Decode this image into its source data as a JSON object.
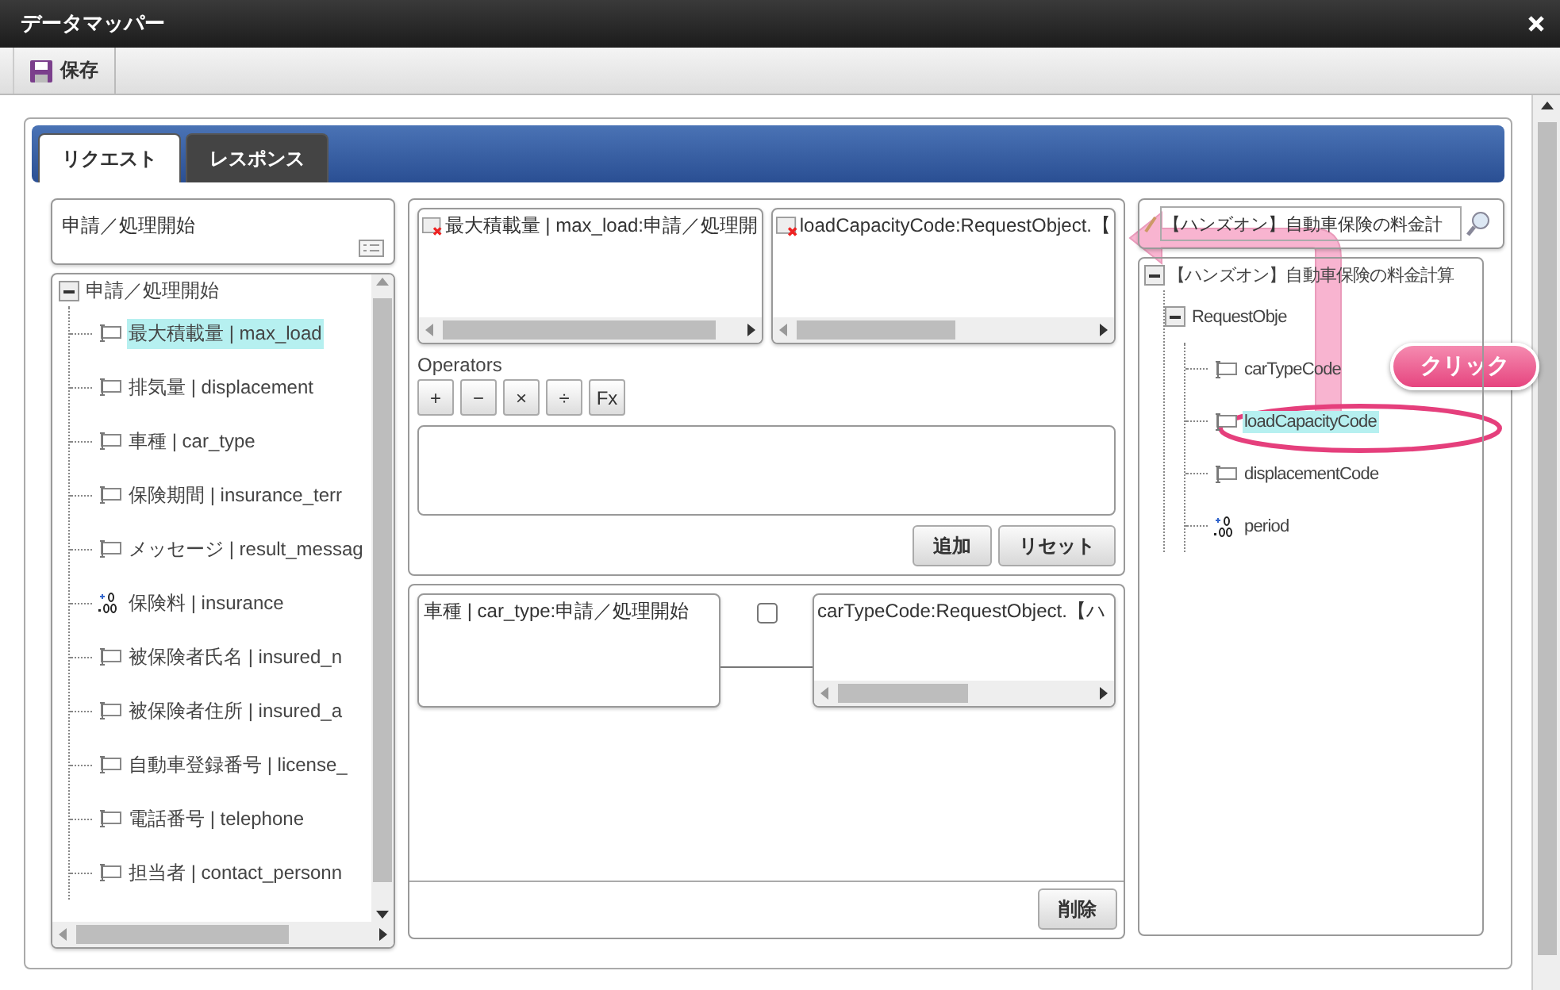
{
  "window": {
    "title": "データマッパー"
  },
  "toolbar": {
    "save": "保存"
  },
  "tabs": [
    {
      "label": "リクエスト",
      "selected": true
    },
    {
      "label": "レスポンス",
      "selected": false
    }
  ],
  "source": {
    "title": "申請／処理開始",
    "tree": {
      "label": "申請／処理開始",
      "expanded": true,
      "children": [
        {
          "label": "最大積載量 | max_load",
          "kind": "text",
          "selected": true
        },
        {
          "label": "排気量 | displacement",
          "kind": "text",
          "selected": false
        },
        {
          "label": "車種 | car_type",
          "kind": "text",
          "selected": false
        },
        {
          "label": "保険期間 | insurance_terr",
          "kind": "text",
          "selected": false
        },
        {
          "label": "メッセージ | result_messag",
          "kind": "text",
          "selected": false
        },
        {
          "label": "保険料 | insurance",
          "kind": "number",
          "selected": false
        },
        {
          "label": "被保険者氏名 | insured_n",
          "kind": "text",
          "selected": false
        },
        {
          "label": "被保険者住所 | insured_a",
          "kind": "text",
          "selected": false
        },
        {
          "label": "自動車登録番号 | license_",
          "kind": "text",
          "selected": false
        },
        {
          "label": "電話番号 | telephone",
          "kind": "text",
          "selected": false
        },
        {
          "label": "担当者 | contact_personn",
          "kind": "text",
          "selected": false
        }
      ]
    }
  },
  "editor": {
    "from": "最大積載量 | max_load:申請／処理開",
    "to": "loadCapacityCode:RequestObject.【",
    "operators_label": "Operators",
    "operators": [
      "+",
      "−",
      "×",
      "÷",
      "Fx"
    ],
    "buttons": [
      "追加",
      "リセット"
    ]
  },
  "mappings": [
    {
      "from": "車種 | car_type:申請／処理開始",
      "to": "carTypeCode:RequestObject.【ハ",
      "checked": false
    }
  ],
  "delete_button": "削除",
  "target": {
    "search": "【ハンズオン】自動車保険の料金計",
    "tree": {
      "label": "【ハンズオン】自動車保険の料金計算",
      "expanded": true,
      "children": [
        {
          "label": "RequestObje",
          "expanded": true,
          "children": [
            {
              "label": "carTypeCode",
              "kind": "text",
              "selected": false
            },
            {
              "label": "loadCapacityCode",
              "kind": "text",
              "selected": true
            },
            {
              "label": "displacementCode",
              "kind": "text",
              "selected": false
            },
            {
              "label": "period",
              "kind": "number",
              "selected": false
            }
          ]
        }
      ]
    }
  },
  "callout": {
    "text": "クリック"
  }
}
